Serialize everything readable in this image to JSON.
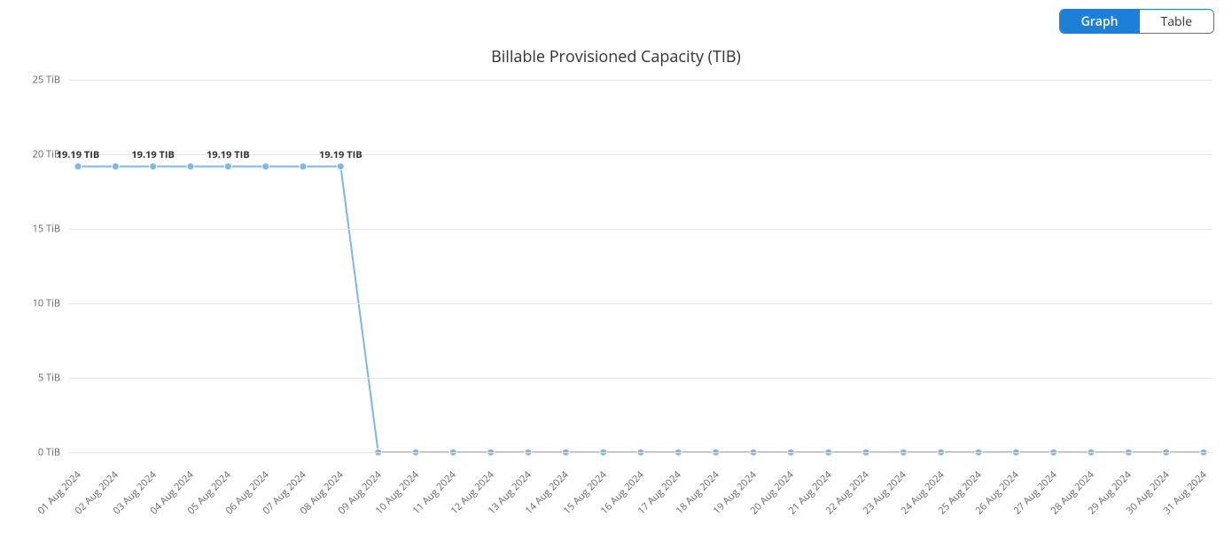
{
  "toggle": {
    "graph": "Graph",
    "table": "Table"
  },
  "chart_data": {
    "type": "line",
    "title": "Billable Provisioned Capacity (TIB)",
    "ylabel_unit": "TiB",
    "ylim": [
      0,
      25
    ],
    "yticks": [
      0,
      5,
      10,
      15,
      20,
      25
    ],
    "categories": [
      "01 Aug 2024",
      "02 Aug 2024",
      "03 Aug 2024",
      "04 Aug 2024",
      "05 Aug 2024",
      "06 Aug 2024",
      "07 Aug 2024",
      "08 Aug 2024",
      "09 Aug 2024",
      "10 Aug 2024",
      "11 Aug 2024",
      "12 Aug 2024",
      "13 Aug 2024",
      "14 Aug 2024",
      "15 Aug 2024",
      "16 Aug 2024",
      "17 Aug 2024",
      "18 Aug 2024",
      "19 Aug 2024",
      "20 Aug 2024",
      "21 Aug 2024",
      "22 Aug 2024",
      "23 Aug 2024",
      "24 Aug 2024",
      "25 Aug 2024",
      "26 Aug 2024",
      "27 Aug 2024",
      "28 Aug 2024",
      "29 Aug 2024",
      "30 Aug 2024",
      "31 Aug 2024"
    ],
    "values": [
      19.19,
      19.19,
      19.19,
      19.19,
      19.19,
      19.19,
      19.19,
      19.19,
      0,
      0,
      0,
      0,
      0,
      0,
      0,
      0,
      0,
      0,
      0,
      0,
      0,
      0,
      0,
      0,
      0,
      0,
      0,
      0,
      0,
      0,
      0
    ],
    "data_labels": [
      {
        "index": 0,
        "text": "19.19 TIB"
      },
      {
        "index": 2,
        "text": "19.19 TIB"
      },
      {
        "index": 4,
        "text": "19.19 TIB"
      },
      {
        "index": 7,
        "text": "19.19 TIB"
      }
    ],
    "line_color": "#7eb6e8",
    "marker_color": "#7eb6e8"
  }
}
